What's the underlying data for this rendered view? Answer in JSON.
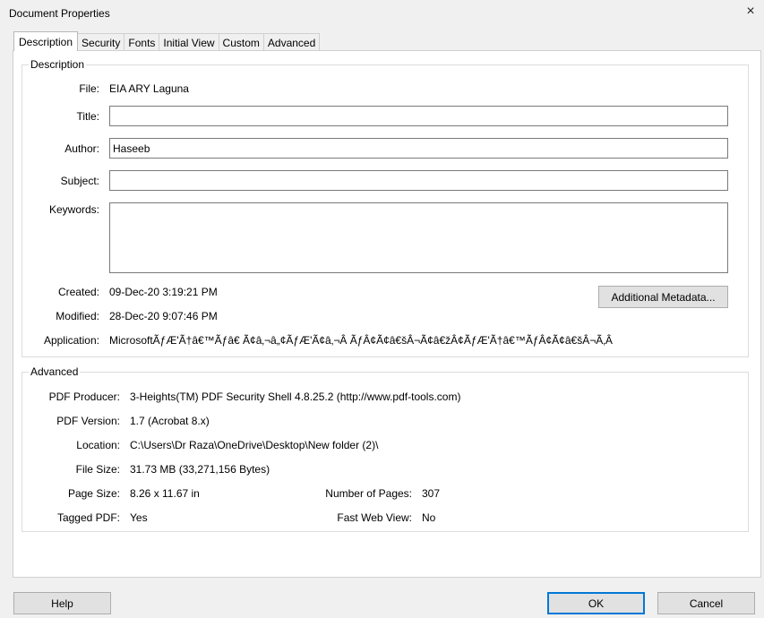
{
  "window": {
    "title": "Document Properties",
    "close_icon": "×"
  },
  "tabs": [
    {
      "label": "Description"
    },
    {
      "label": "Security"
    },
    {
      "label": "Fonts"
    },
    {
      "label": "Initial View"
    },
    {
      "label": "Custom"
    },
    {
      "label": "Advanced"
    }
  ],
  "description": {
    "legend": "Description",
    "file_label": "File:",
    "file_value": "EIA ARY Laguna",
    "title_label": "Title:",
    "title_value": "",
    "author_label": "Author:",
    "author_value": "Haseeb",
    "subject_label": "Subject:",
    "subject_value": "",
    "keywords_label": "Keywords:",
    "keywords_value": "",
    "created_label": "Created:",
    "created_value": "09-Dec-20 3:19:21 PM",
    "modified_label": "Modified:",
    "modified_value": "28-Dec-20 9:07:46 PM",
    "application_label": "Application:",
    "application_value": "MicrosoftÃƒÆ'Ã†â€™Ãƒâ€ Ã¢â‚¬â„¢ÃƒÆ'Ã¢â‚¬Â ÃƒÂ¢Ã¢â€šÂ¬Ã¢â€žÂ¢ÃƒÆ'Ã†â€™ÃƒÂ¢Ã¢â€šÂ¬Ã‚Â",
    "additional_metadata_button": "Additional Metadata..."
  },
  "advanced": {
    "legend": "Advanced",
    "producer_label": "PDF Producer:",
    "producer_value": "3-Heights(TM) PDF Security Shell 4.8.25.2 (http://www.pdf-tools.com)",
    "version_label": "PDF Version:",
    "version_value": "1.7 (Acrobat 8.x)",
    "location_label": "Location:",
    "location_value": "C:\\Users\\Dr Raza\\OneDrive\\Desktop\\New folder (2)\\",
    "filesize_label": "File Size:",
    "filesize_value": "31.73 MB (33,271,156 Bytes)",
    "pagesize_label": "Page Size:",
    "pagesize_value": "8.26 x 11.67 in",
    "pages_label": "Number of Pages:",
    "pages_value": "307",
    "tagged_label": "Tagged PDF:",
    "tagged_value": "Yes",
    "fastweb_label": "Fast Web View:",
    "fastweb_value": "No"
  },
  "footer": {
    "help": "Help",
    "ok": "OK",
    "cancel": "Cancel"
  }
}
